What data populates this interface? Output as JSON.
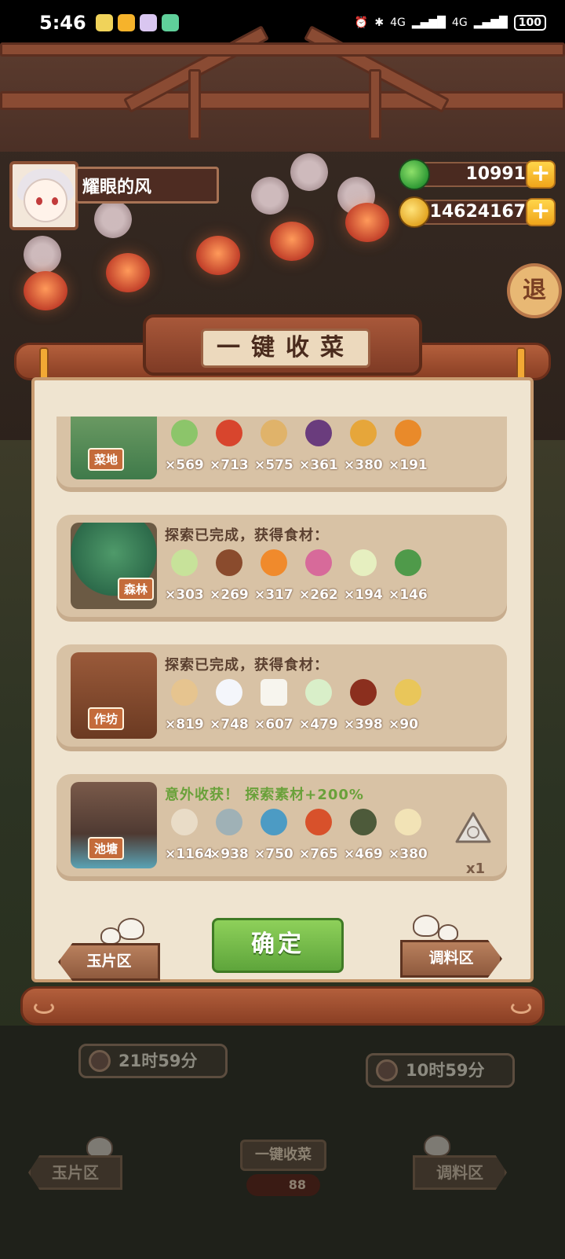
{
  "status_bar": {
    "time": "5:46",
    "net1": "4G",
    "net2": "4G",
    "battery": "100"
  },
  "player": {
    "name": "耀眼的风"
  },
  "currencies": {
    "jade": "10991",
    "coins": "14624167",
    "add_symbol": "+"
  },
  "exit_label": "退",
  "dialog": {
    "title": "一键收菜",
    "cards": [
      {
        "tag": "菜地",
        "message": "",
        "items": [
          {
            "icon": "scallion-icon",
            "qty": "×569",
            "color": "#8cc56a"
          },
          {
            "icon": "chili-icon",
            "qty": "×713",
            "color": "#d8452d"
          },
          {
            "icon": "potato-icon",
            "qty": "×575",
            "color": "#e0b36a"
          },
          {
            "icon": "eggplant-icon",
            "qty": "×361",
            "color": "#6a3c7d"
          },
          {
            "icon": "pineapple-icon",
            "qty": "×380",
            "color": "#e6a63a"
          },
          {
            "icon": "pumpkin-icon",
            "qty": "×191",
            "color": "#e98a2a"
          }
        ]
      },
      {
        "tag": "森林",
        "message": "探索已完成，获得食材：",
        "items": [
          {
            "icon": "cabbage-icon",
            "qty": "×303",
            "color": "#c7e29a"
          },
          {
            "icon": "mushroom-icon",
            "qty": "×269",
            "color": "#8a4b2d"
          },
          {
            "icon": "carrot-icon",
            "qty": "×317",
            "color": "#f08a2c"
          },
          {
            "icon": "radish-icon",
            "qty": "×262",
            "color": "#d76a9a"
          },
          {
            "icon": "bamboo-shoot-icon",
            "qty": "×194",
            "color": "#e6efc0"
          },
          {
            "icon": "herb-icon",
            "qty": "×146",
            "color": "#4f9a4a"
          }
        ]
      },
      {
        "tag": "作坊",
        "message": "探索已完成，获得食材：",
        "items": [
          {
            "icon": "flour-sack-icon",
            "qty": "×819",
            "color": "#e6c48f"
          },
          {
            "icon": "rice-bowl-icon",
            "qty": "×748",
            "color": "#f4f6fb"
          },
          {
            "icon": "tofu-icon",
            "qty": "×607",
            "color": "#f7f5ee"
          },
          {
            "icon": "rice-ball-icon",
            "qty": "×479",
            "color": "#d9efc9"
          },
          {
            "icon": "jar-icon",
            "qty": "×398",
            "color": "#8b2f1e"
          },
          {
            "icon": "sauce-boat-icon",
            "qty": "×90",
            "color": "#e9c65a"
          }
        ]
      },
      {
        "tag": "池塘",
        "message": "意外收获！ 探索素材+200%",
        "items": [
          {
            "icon": "clam-icon",
            "qty": "×1164",
            "color": "#e9dcc7"
          },
          {
            "icon": "shrimp-icon",
            "qty": "×938",
            "color": "#9fb1b6"
          },
          {
            "icon": "fish-icon",
            "qty": "×750",
            "color": "#4c9bc4"
          },
          {
            "icon": "fish-meat-icon",
            "qty": "×765",
            "color": "#d8512b"
          },
          {
            "icon": "crab-icon",
            "qty": "×469",
            "color": "#4d5a3a"
          },
          {
            "icon": "fin-icon",
            "qty": "×380",
            "color": "#f2e3b6"
          }
        ],
        "bonus_count": "x1"
      }
    ],
    "confirm_label": "确定",
    "left_label": "玉片区",
    "right_label": "调料区"
  },
  "background": {
    "timer_left": "21时59分",
    "timer_right": "10时59分",
    "left_label": "玉片区",
    "right_label": "调料区",
    "center_label": "一键收菜",
    "center_cost": "88"
  },
  "colors": {
    "accent_green": "#6aa13a",
    "parchment": "#efe4d0",
    "card": "#d8c2a5",
    "wood": "#8a3f24"
  }
}
